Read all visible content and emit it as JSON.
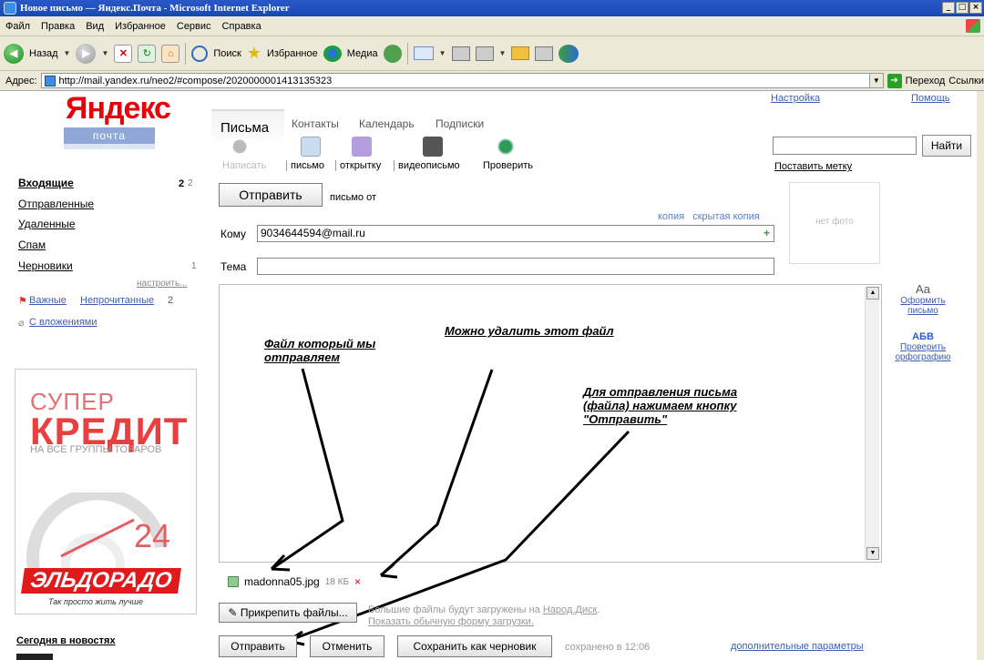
{
  "window": {
    "title": "Новое письмо — Яндекс.Почта - Microsoft Internet Explorer",
    "controls": [
      "_",
      "□",
      "×"
    ]
  },
  "menu": [
    "Файл",
    "Правка",
    "Вид",
    "Избранное",
    "Сервис",
    "Справка"
  ],
  "toolbar": {
    "back": "Назад",
    "search": "Поиск",
    "favorites": "Избранное",
    "media": "Медиа"
  },
  "address": {
    "label": "Адрес:",
    "url": "http://mail.yandex.ru/neo2/#compose/2020000001413135323",
    "go": "Переход",
    "links": "Ссылки"
  },
  "header": {
    "logo": "Яндекс",
    "logo_sub": "почта",
    "settings": "Настройка",
    "help": "Помощь"
  },
  "tabs": [
    "Письма",
    "Контакты",
    "Календарь",
    "Подписки"
  ],
  "tools": [
    "Написать",
    "письмо",
    "открытку",
    "видеописьмо",
    "Проверить"
  ],
  "search": {
    "button": "Найти",
    "put_mark": "Поставить метку"
  },
  "sidebar": {
    "folders": [
      {
        "name": "Входящие",
        "count": "2",
        "total": "2"
      },
      {
        "name": "Отправленные",
        "count": ""
      },
      {
        "name": "Удаленные",
        "count": ""
      },
      {
        "name": "Спам",
        "count": ""
      },
      {
        "name": "Черновики",
        "count": "1"
      }
    ],
    "configure": "настроить...",
    "important": "Важные",
    "unread": "Непрочитанные",
    "unread_count": "2",
    "with_attachments": "С вложениями",
    "news_title": "Сегодня в новостях"
  },
  "ad": {
    "line1": "СУПЕР",
    "line2": "КРЕДИТ",
    "line3": "НА ВСЕ ГРУППЫ ТОВАРОВ",
    "number": "24",
    "brand": "ЭЛЬДОРАДО",
    "slogan": "Так просто жить лучше"
  },
  "compose": {
    "send_top": "Отправить",
    "letter_from": "письмо от",
    "copy": "копия",
    "hidden_copy": "скрытая копия",
    "to_label": "Кому",
    "to_value": "9034644594@mail.ru",
    "subject_label": "Тема",
    "subject_value": "",
    "no_photo": "нет фото",
    "add_icon": "+"
  },
  "right_tools": {
    "format_glyph": "Aa",
    "format": "Оформить письмо",
    "spell_glyph": "АБВ",
    "spell": "Проверить орфографию"
  },
  "annotations": {
    "file_sent": "Файл который мы отправляем",
    "can_delete": "Можно удалить этот файл",
    "send_hint": "Для отправления письма (файла) нажимаем кнопку \"Отправить\""
  },
  "attachment": {
    "name": "madonna05.jpg",
    "size": "18 КБ",
    "remove": "×"
  },
  "upload": {
    "attach_button": "Прикрепить файлы...",
    "note_prefix": "Большие файлы будут загружены на",
    "note_link": "Народ.Диск",
    "note_line2": "Показать обычную форму загрузки."
  },
  "footer": {
    "send": "Отправить",
    "cancel": "Отменить",
    "save_draft": "Сохранить как черновик",
    "saved": "сохранено в 12:06",
    "extra_params": "дополнительные параметры"
  },
  "colors": {
    "yandex_red": "#e8000a",
    "link_blue": "#3a5fb0",
    "annotation_arrow": "#000000"
  }
}
